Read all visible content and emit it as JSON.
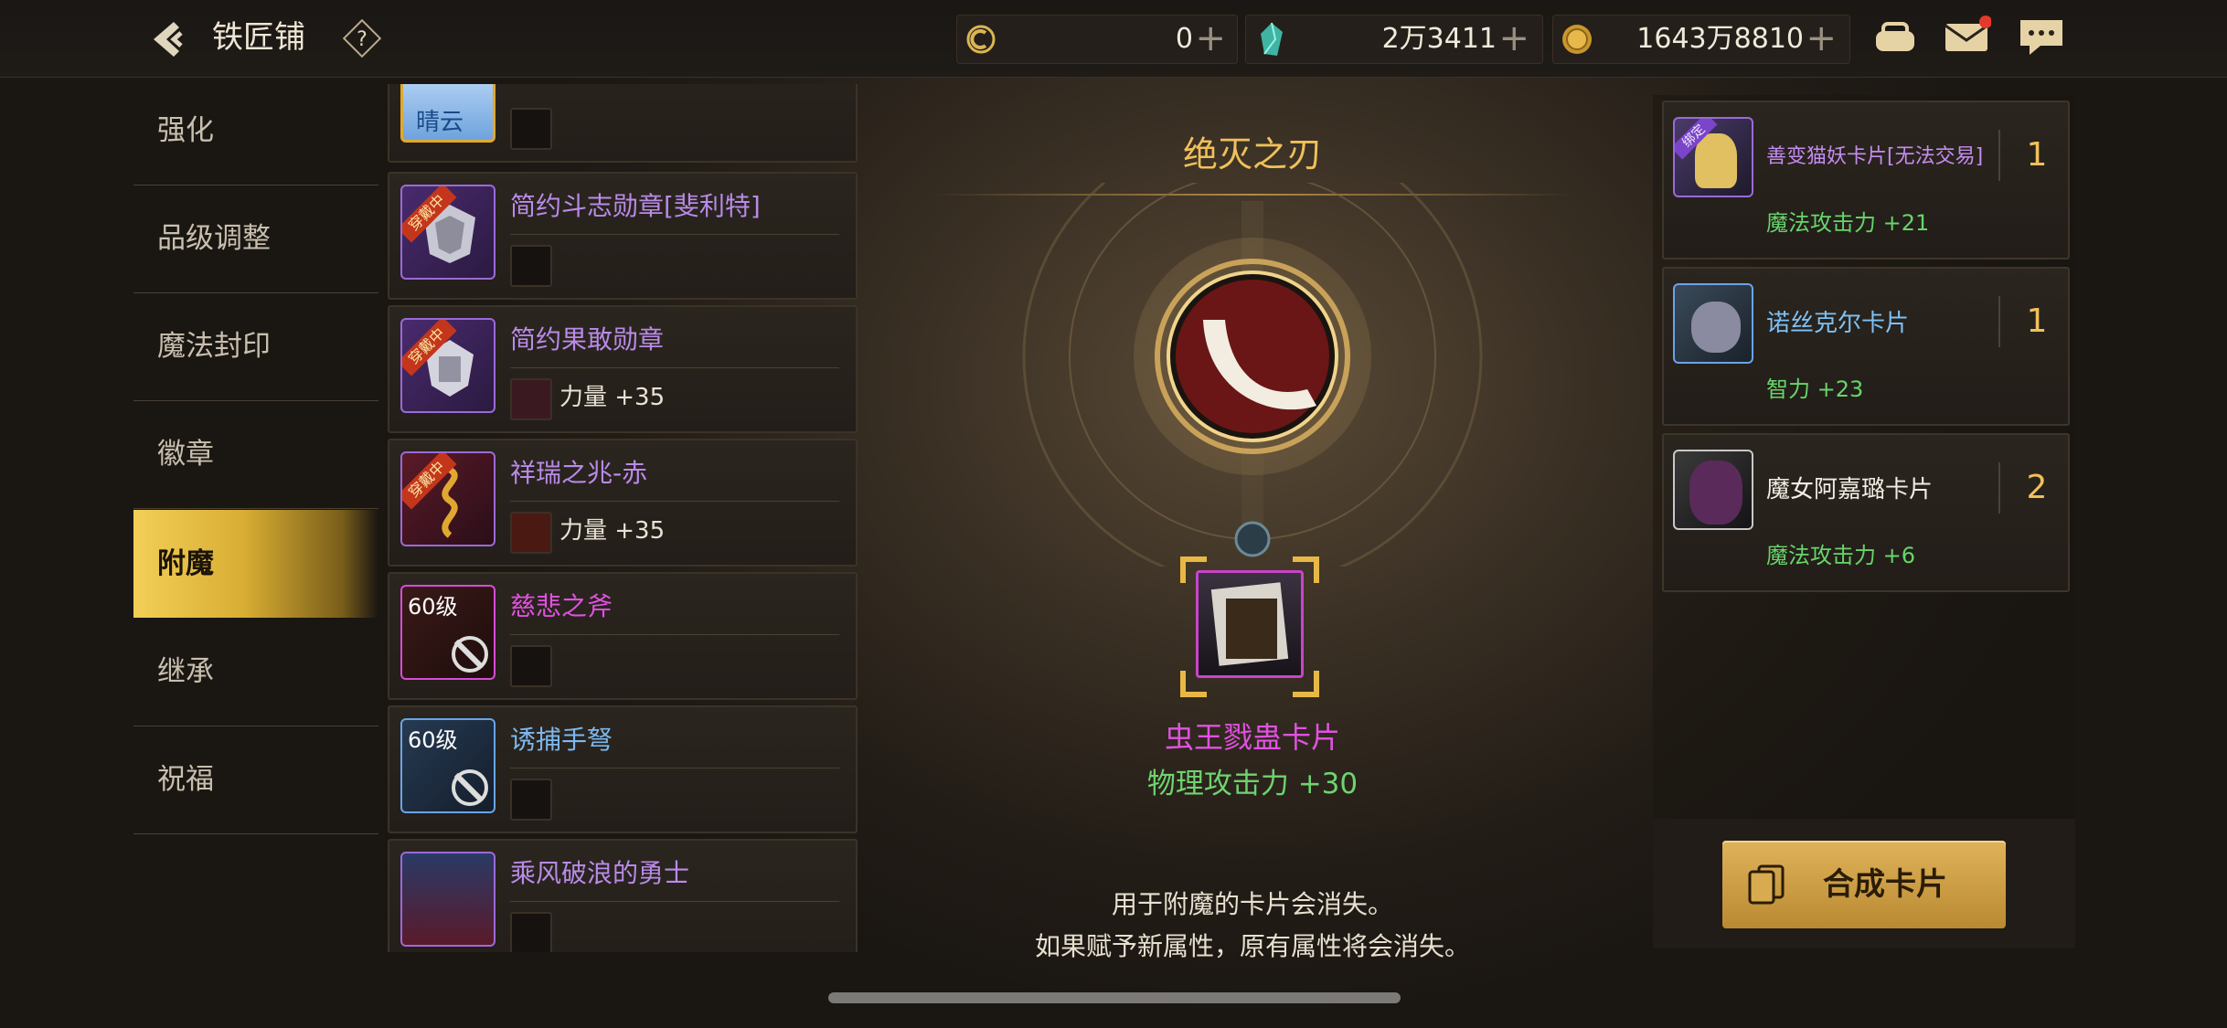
{
  "header": {
    "title": "铁匠铺",
    "currencies": [
      {
        "icon": "token-c-icon",
        "value": "0"
      },
      {
        "icon": "crystal-icon",
        "value": "2万3411"
      },
      {
        "icon": "gold-coin-icon",
        "value": "1643万8810"
      }
    ],
    "plus_glyph": "+"
  },
  "nav": {
    "items": [
      "强化",
      "品级调整",
      "魔法封印",
      "徽章",
      "附魔",
      "继承",
      "祝福"
    ],
    "active_index": 4
  },
  "equipment": {
    "first_partial": {
      "thumb_text": "晴云"
    },
    "items": [
      {
        "name": "简约斗志勋章[斐利特]",
        "badge": "穿戴中",
        "stat": "",
        "name_color": "#b98be8"
      },
      {
        "name": "简约果敢勋章",
        "badge": "穿戴中",
        "stat": "力量 +35",
        "name_color": "#b98be8"
      },
      {
        "name": "祥瑞之兆-赤",
        "badge": "穿戴中",
        "stat": "力量 +35",
        "name_color": "#b98be8"
      },
      {
        "name": "慈悲之斧",
        "level": "60级",
        "stat": "",
        "name_color": "#e052e0"
      },
      {
        "name": "诱捕手弩",
        "level": "60级",
        "stat": "",
        "name_color": "#7db8f0"
      },
      {
        "name": "乘风破浪的勇士",
        "stat": "",
        "name_color": "#b98be8"
      }
    ]
  },
  "center": {
    "item_name": "绝灭之刃",
    "card_name": "虫王戮蛊卡片",
    "card_stat": "物理攻击力 +30",
    "notice_line1": "用于附魔的卡片会消失。",
    "notice_line2": "如果赋予新属性，原有属性将会消失。"
  },
  "cards": [
    {
      "name": "善变猫妖卡片[无法交易]",
      "tag": "绑定",
      "count": "1",
      "stat": "魔法攻击力 +21",
      "name_color": "#c58cf0"
    },
    {
      "name": "诺丝克尔卡片",
      "count": "1",
      "stat": "智力 +23",
      "name_color": "#7ec1f5"
    },
    {
      "name": "魔女阿嘉璐卡片",
      "count": "2",
      "stat": "魔法攻击力 +6",
      "name_color": "#f2ede4"
    }
  ],
  "compose_button": "合成卡片",
  "colors": {
    "accent_gold": "#f0c05a",
    "stat_green": "#6fd36f",
    "nav_active": "#e3b33f"
  }
}
